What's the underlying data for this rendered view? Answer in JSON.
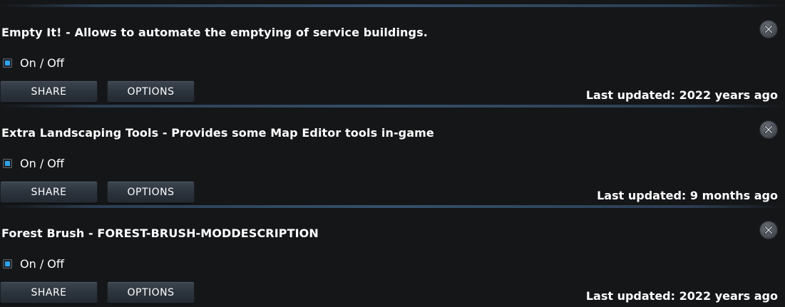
{
  "mods": [
    {
      "title": "Empty It! - Allows to automate the emptying of service buildings.",
      "toggle_label": "On / Off",
      "enabled": true,
      "share_label": "SHARE",
      "options_label": "OPTIONS",
      "last_updated": "Last updated: 2022 years ago"
    },
    {
      "title": "Extra Landscaping Tools - Provides some Map Editor tools in-game",
      "toggle_label": "On / Off",
      "enabled": true,
      "share_label": "SHARE",
      "options_label": "OPTIONS",
      "last_updated": "Last updated: 9 months ago"
    },
    {
      "title": "Forest Brush - FOREST-BRUSH-MODDESCRIPTION",
      "toggle_label": "On / Off",
      "enabled": true,
      "share_label": "SHARE",
      "options_label": "OPTIONS",
      "last_updated": "Last updated: 2022 years ago"
    }
  ],
  "icons": {
    "close": "close-icon",
    "checkbox": "checkbox-checked-icon"
  },
  "colors": {
    "background": "#151618",
    "checkbox_fill": "#2da3ec",
    "button_top": "#3d4650",
    "button_bottom": "#242a31",
    "divider": "#35506a"
  }
}
